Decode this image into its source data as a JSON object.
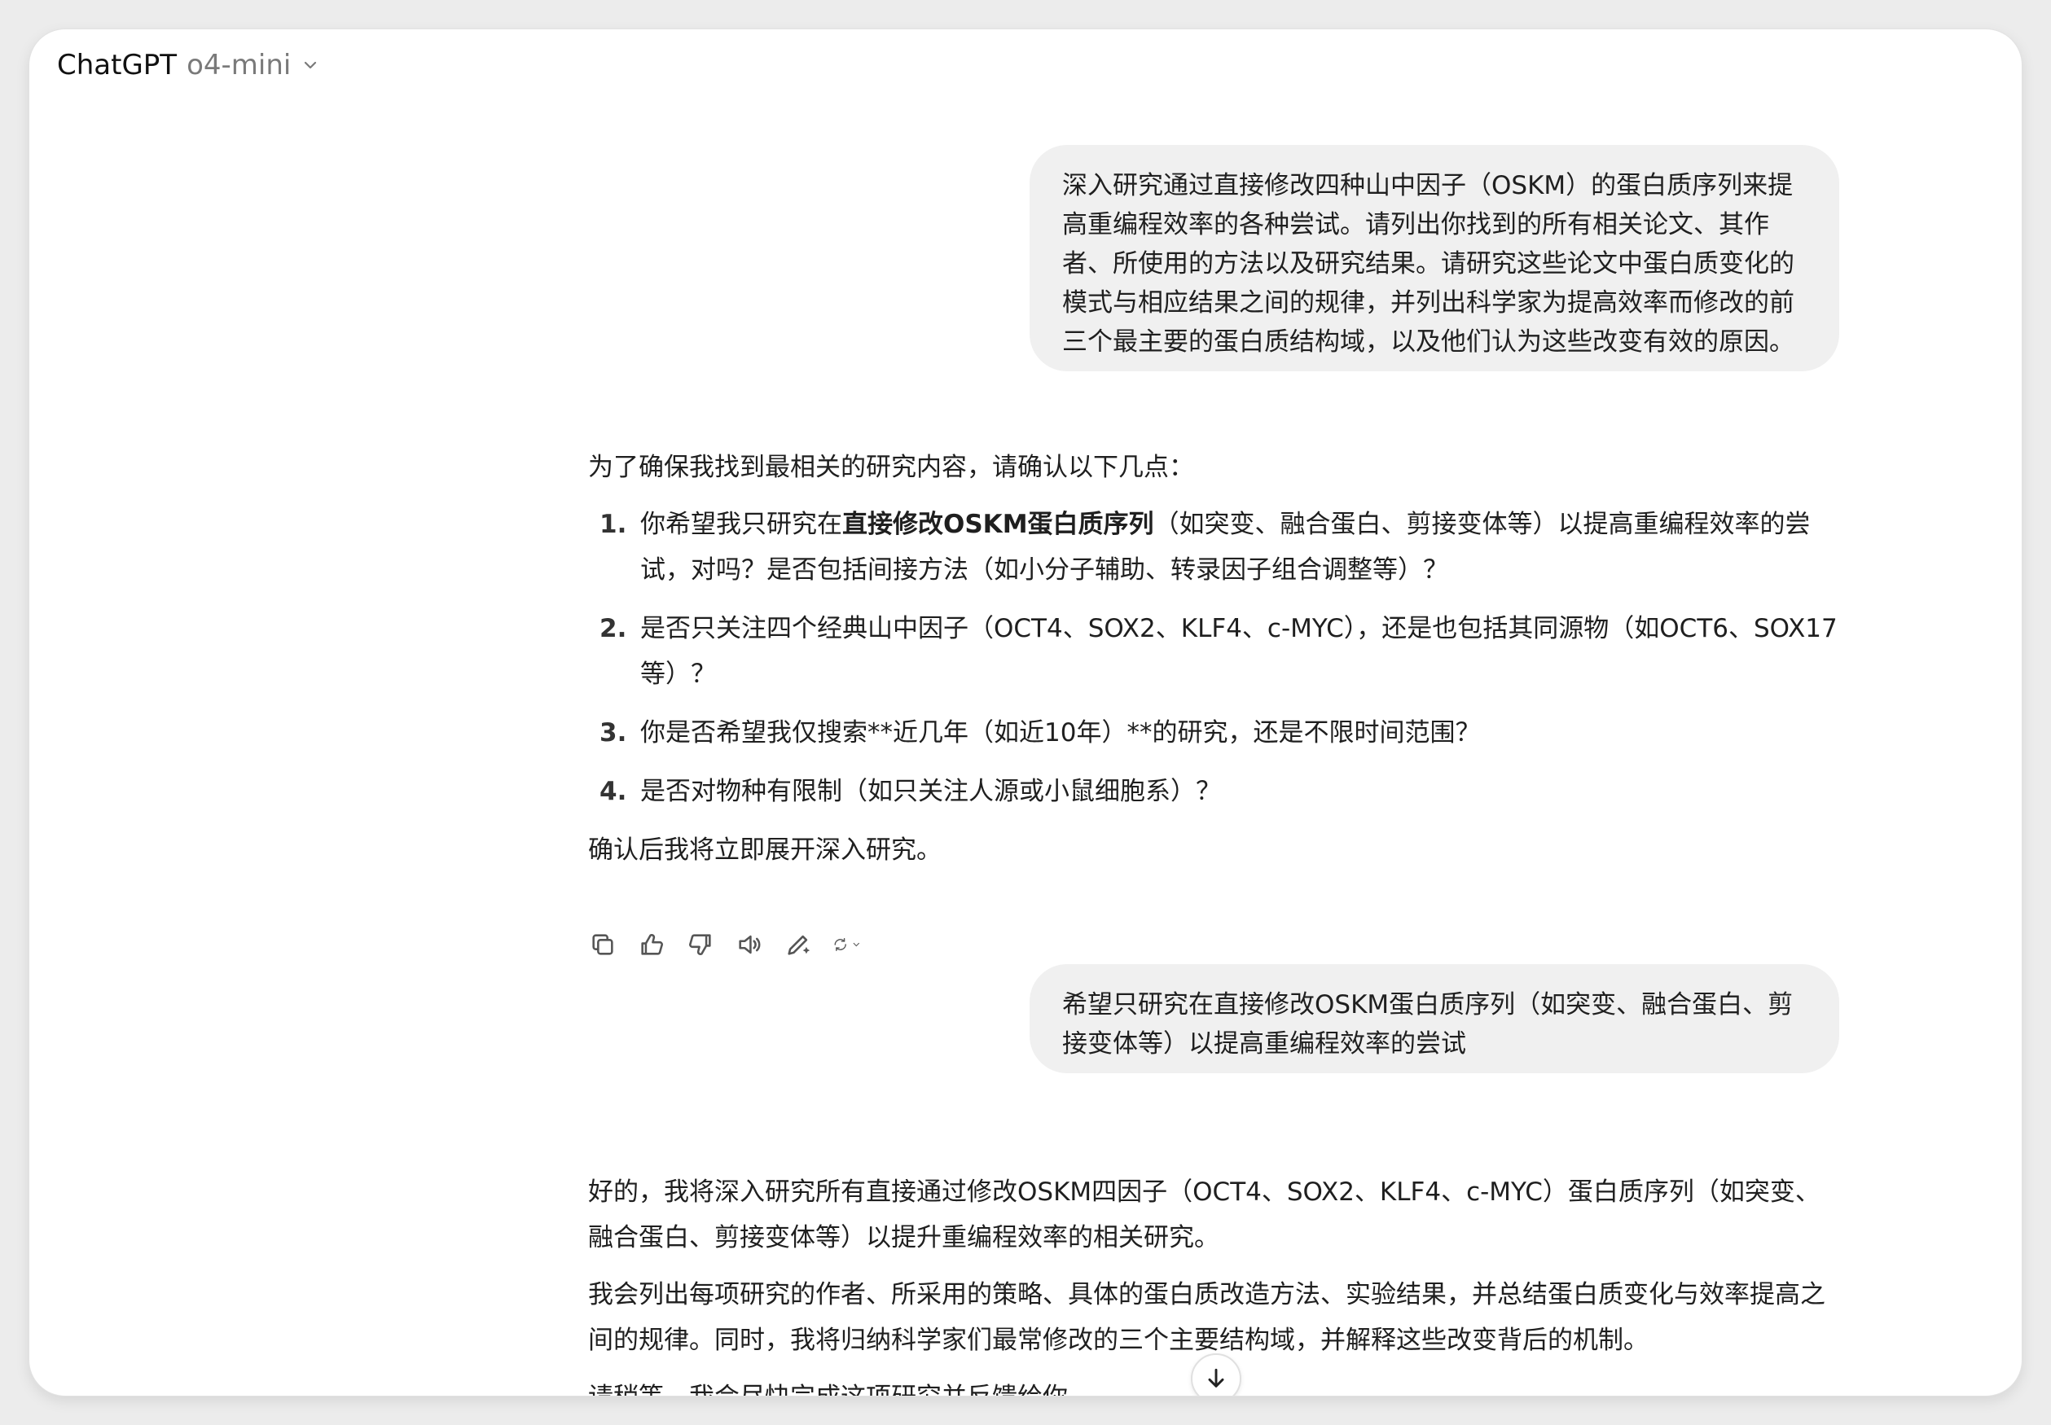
{
  "header": {
    "app_name": "ChatGPT",
    "model_name": "o4-mini"
  },
  "messages": {
    "user_1": "深入研究通过直接修改四种山中因子（OSKM）的蛋白质序列来提高重编程效率的各种尝试。请列出你找到的所有相关论文、其作者、所使用的方法以及研究结果。请研究这些论文中蛋白质变化的模式与相应结果之间的规律，并列出科学家为提高效率而修改的前三个最主要的蛋白质结构域，以及他们认为这些改变有效的原因。",
    "assistant_1": {
      "intro": "为了确保我找到最相关的研究内容，请确认以下几点：",
      "items": [
        {
          "num": "1.",
          "before": "你希望我只研究在",
          "bold": "直接修改OSKM蛋白质序列",
          "after": "（如突变、融合蛋白、剪接变体等）以提高重编程效率的尝试，对吗？是否包括间接方法（如小分子辅助、转录因子组合调整等）？"
        },
        {
          "num": "2.",
          "before": "是否只关注四个经典山中因子（OCT4、SOX2、KLF4、c-MYC），还是也包括其同源物（如OCT6、SOX17等）？",
          "bold": "",
          "after": ""
        },
        {
          "num": "3.",
          "before": "你是否希望我仅搜索**近几年（如近10年）**的研究，还是不限时间范围？",
          "bold": "",
          "after": ""
        },
        {
          "num": "4.",
          "before": "是否对物种有限制（如只关注人源或小鼠细胞系）？",
          "bold": "",
          "after": ""
        }
      ],
      "outro": "确认后我将立即展开深入研究。"
    },
    "user_2": "希望只研究在直接修改OSKM蛋白质序列（如突变、融合蛋白、剪接变体等）以提高重编程效率的尝试",
    "assistant_2": {
      "p1": "好的，我将深入研究所有直接通过修改OSKM四因子（OCT4、SOX2、KLF4、c-MYC）蛋白质序列（如突变、融合蛋白、剪接变体等）以提升重编程效率的相关研究。",
      "p2": "我会列出每项研究的作者、所采用的策略、具体的蛋白质改造方法、实验结果，并总结蛋白质变化与效率提高之间的规律。同时，我将归纳科学家们最常修改的三个主要结构域，并解释这些改变背后的机制。",
      "p3": "请稍等，我会尽快完成这项研究并反馈给你。"
    }
  },
  "action_icons": [
    "copy-icon",
    "thumbs-up-icon",
    "thumbs-down-icon",
    "read-aloud-icon",
    "edit-icon",
    "regenerate-icon"
  ],
  "colors": {
    "bubble_bg": "#f0f0f0",
    "text": "#1f1f1f",
    "muted": "#7a7a7a"
  }
}
